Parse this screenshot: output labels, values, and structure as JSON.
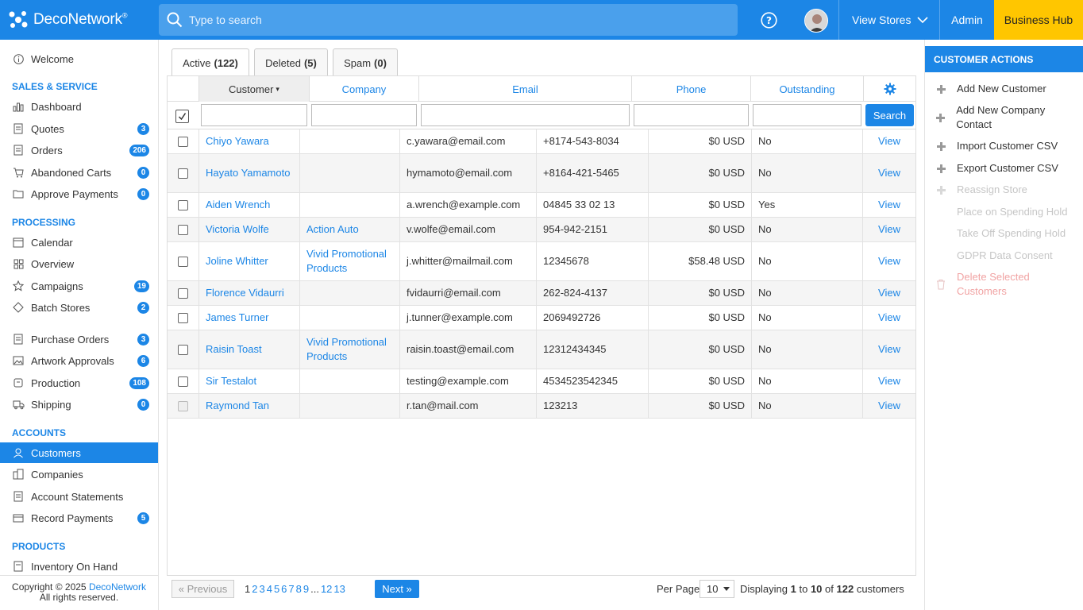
{
  "header": {
    "brand": "DecoNetwork",
    "brand_mark": "®",
    "search_placeholder": "Type to search",
    "view_stores": "View Stores",
    "admin": "Admin",
    "business_hub": "Business Hub"
  },
  "sidebar": {
    "welcome": "Welcome",
    "sections": {
      "sales": "SALES & SERVICE",
      "processing": "PROCESSING",
      "accounts": "ACCOUNTS",
      "products": "PRODUCTS"
    },
    "items": [
      {
        "label": "Dashboard",
        "badge": ""
      },
      {
        "label": "Quotes",
        "badge": "3"
      },
      {
        "label": "Orders",
        "badge": "206"
      },
      {
        "label": "Abandoned Carts",
        "badge": "0"
      },
      {
        "label": "Approve Payments",
        "badge": "0"
      },
      {
        "label": "Calendar",
        "badge": ""
      },
      {
        "label": "Overview",
        "badge": ""
      },
      {
        "label": "Campaigns",
        "badge": "19"
      },
      {
        "label": "Batch Stores",
        "badge": "2"
      },
      {
        "label": "Purchase Orders",
        "badge": "3"
      },
      {
        "label": "Artwork Approvals",
        "badge": "6"
      },
      {
        "label": "Production",
        "badge": "108"
      },
      {
        "label": "Shipping",
        "badge": "0"
      },
      {
        "label": "Customers",
        "badge": ""
      },
      {
        "label": "Companies",
        "badge": ""
      },
      {
        "label": "Account Statements",
        "badge": ""
      },
      {
        "label": "Record Payments",
        "badge": "5"
      },
      {
        "label": "Inventory On Hand",
        "badge": ""
      }
    ],
    "copyright_prefix": "Copyright © 2025",
    "copyright_link": "DecoNetwork",
    "copyright_suffix": "All rights reserved."
  },
  "tabs": [
    {
      "label": "Active",
      "count": "(122)"
    },
    {
      "label": "Deleted",
      "count": "(5)"
    },
    {
      "label": "Spam",
      "count": "(0)"
    }
  ],
  "table": {
    "columns": [
      "Customer",
      "Company",
      "Email",
      "Phone",
      "Outstanding"
    ],
    "sort_caret": "▾",
    "search_button": "Search",
    "view_label": "View",
    "rows": [
      {
        "customer": "Chiyo Yawara",
        "company": "",
        "email": "c.yawara@email.com",
        "phone": "+8174-543-8034",
        "outstanding": "$0 USD",
        "flag": "No"
      },
      {
        "customer": "Hayato Yamamoto",
        "company": "",
        "email": "hymamoto@email.com",
        "phone": "+8164-421-5465",
        "outstanding": "$0 USD",
        "flag": "No"
      },
      {
        "customer": "Aiden Wrench",
        "company": "",
        "email": "a.wrench@example.com",
        "phone": "04845 33 02 13",
        "outstanding": "$0 USD",
        "flag": "Yes"
      },
      {
        "customer": "Victoria Wolfe",
        "company": "Action Auto",
        "email": "v.wolfe@email.com",
        "phone": "954-942-2151",
        "outstanding": "$0 USD",
        "flag": "No"
      },
      {
        "customer": "Joline Whitter",
        "company": "Vivid Promotional Products",
        "email": "j.whitter@mailmail.com",
        "phone": "12345678",
        "outstanding": "$58.48 USD",
        "flag": "No"
      },
      {
        "customer": "Florence Vidaurri",
        "company": "",
        "email": "fvidaurri@email.com",
        "phone": "262-824-4137",
        "outstanding": "$0 USD",
        "flag": "No"
      },
      {
        "customer": "James Turner",
        "company": "",
        "email": "j.tunner@example.com",
        "phone": "2069492726",
        "outstanding": "$0 USD",
        "flag": "No"
      },
      {
        "customer": "Raisin Toast",
        "company": "Vivid Promotional Products",
        "email": "raisin.toast@email.com",
        "phone": "12312434345",
        "outstanding": "$0 USD",
        "flag": "No"
      },
      {
        "customer": "Sir Testalot",
        "company": "",
        "email": "testing@example.com",
        "phone": "4534523542345",
        "outstanding": "$0 USD",
        "flag": "No"
      },
      {
        "customer": "Raymond Tan",
        "company": "",
        "email": "r.tan@mail.com",
        "phone": "123213",
        "outstanding": "$0 USD",
        "flag": "No"
      }
    ]
  },
  "pager": {
    "previous": "« Previous",
    "pages": [
      "1",
      "2",
      "3",
      "4",
      "5",
      "6",
      "7",
      "8",
      "9",
      "...",
      "12",
      "13"
    ],
    "next": "Next »",
    "per_page_label": "Per Page",
    "per_page_value": "10",
    "displaying": "Displaying",
    "from": "1",
    "to_word": "to",
    "to": "10",
    "of_word": "of",
    "total": "122",
    "unit": "customers"
  },
  "actions": {
    "title": "CUSTOMER ACTIONS",
    "items": [
      {
        "label": "Add New Customer"
      },
      {
        "label": "Add New Company Contact"
      },
      {
        "label": "Import Customer CSV"
      },
      {
        "label": "Export Customer CSV"
      },
      {
        "label": "Reassign Store"
      },
      {
        "label": "Place on Spending Hold"
      },
      {
        "label": "Take Off Spending Hold"
      },
      {
        "label": "GDPR Data Consent"
      },
      {
        "label": "Delete Selected Customers"
      }
    ]
  },
  "colors": {
    "primary": "#1c86e6",
    "business_hub": "#ffc600"
  }
}
